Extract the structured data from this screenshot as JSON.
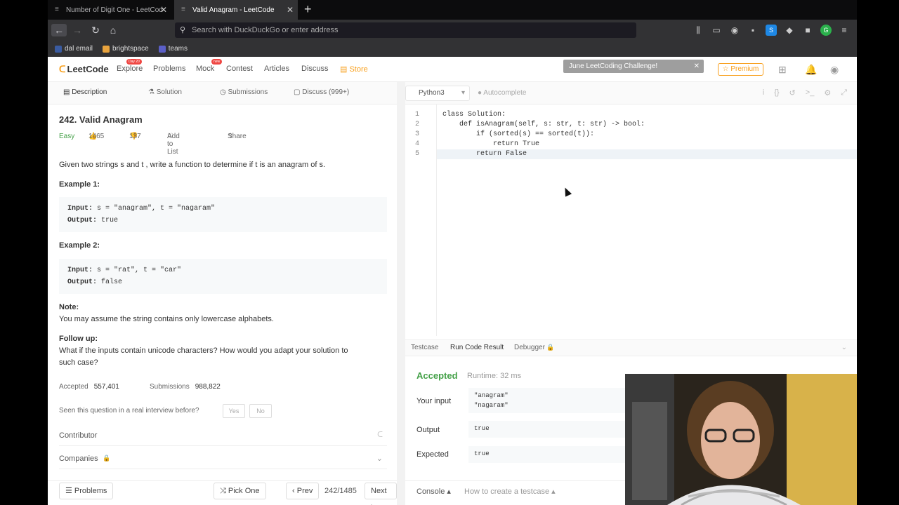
{
  "browser": {
    "tabs": [
      {
        "title": "Number of Digit One - LeetCod",
        "active": false
      },
      {
        "title": "Valid Anagram - LeetCode",
        "active": true
      }
    ],
    "address_placeholder": "Search with DuckDuckGo or enter address",
    "bookmarks": [
      {
        "label": "dal email",
        "color": "#3a5ba0"
      },
      {
        "label": "brightspace",
        "color": "#e8a33d"
      },
      {
        "label": "teams",
        "color": "#5b5fc7"
      }
    ]
  },
  "header": {
    "logo": "LeetCode",
    "nav": [
      {
        "label": "Explore",
        "badge": "Day 20"
      },
      {
        "label": "Problems",
        "badge": ""
      },
      {
        "label": "Mock",
        "badge": "new"
      },
      {
        "label": "Contest",
        "badge": ""
      },
      {
        "label": "Articles",
        "badge": ""
      },
      {
        "label": "Discuss",
        "badge": ""
      }
    ],
    "store": "Store",
    "challenge": "June LeetCoding Challenge!",
    "premium": "Premium"
  },
  "left_tabs": [
    "Description",
    "Solution",
    "Submissions",
    "Discuss (999+)"
  ],
  "problem": {
    "title": "242. Valid Anagram",
    "difficulty": "Easy",
    "likes": "1465",
    "dislikes": "137",
    "add_to_list": "Add to List",
    "share": "Share",
    "description": "Given two strings s and t , write a function to determine if t is an anagram of s.",
    "example1_title": "Example 1:",
    "example1_input": "s = \"anagram\", t = \"nagaram\"",
    "example1_output": "true",
    "example2_title": "Example 2:",
    "example2_input": "s = \"rat\", t = \"car\"",
    "example2_output": "false",
    "input_label": "Input:",
    "output_label": "Output:",
    "note_title": "Note:",
    "note_text": "You may assume the string contains only lowercase alphabets.",
    "followup_title": "Follow up:",
    "followup_text_1": "What if the inputs contain unicode characters? How would you adapt your solution to",
    "followup_text_2": "such case?",
    "accepted_label": "Accepted",
    "accepted_value": "557,401",
    "submissions_label": "Submissions",
    "submissions_value": "988,822",
    "interview_q": "Seen this question in a real interview before?",
    "yes": "Yes",
    "no": "No",
    "contributor": "Contributor",
    "companies": "Companies"
  },
  "bottom_left": {
    "problems": "Problems",
    "pick_one": "Pick One",
    "prev": "Prev",
    "page": "242/1485",
    "next": "Next"
  },
  "editor": {
    "language": "Python3",
    "autocomplete": "Autocomplete",
    "lines": [
      {
        "n": "1",
        "text": "class Solution:"
      },
      {
        "n": "2",
        "text": "    def isAnagram(self, s: str, t: str) -> bool:"
      },
      {
        "n": "3",
        "text": "        if (sorted(s) == sorted(t)):"
      },
      {
        "n": "4",
        "text": "            return True"
      },
      {
        "n": "5",
        "text": "        return False"
      }
    ]
  },
  "result": {
    "tabs": [
      "Testcase",
      "Run Code Result",
      "Debugger"
    ],
    "status": "Accepted",
    "runtime": "Runtime: 32 ms",
    "your_input_label": "Your input",
    "your_input_1": "\"anagram\"",
    "your_input_2": "\"nagaram\"",
    "output_label": "Output",
    "output_value": "true",
    "expected_label": "Expected",
    "expected_value": "true"
  },
  "bottom_right": {
    "console": "Console",
    "testcase_help": "How to create a testcase"
  }
}
